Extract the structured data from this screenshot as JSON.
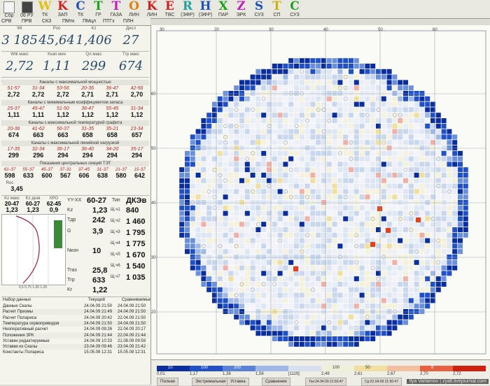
{
  "toolbar": {
    "buttons": [
      {
        "big": "",
        "small": "Сбр",
        "color": "#a0a0a0"
      },
      {
        "big": "",
        "small": "06 РУ",
        "color": "#606060"
      },
      {
        "big": "W",
        "small": "ТК",
        "color": "#e0c010"
      },
      {
        "big": "K",
        "small": "ЗАП",
        "color": "#d02020"
      },
      {
        "big": "C",
        "small": "ТК",
        "color": "#2050c0"
      },
      {
        "big": "T",
        "small": "ГР",
        "color": "#20a020"
      },
      {
        "big": "T",
        "small": "ГАЗА",
        "color": "#c020c0"
      },
      {
        "big": "O",
        "small": "ЛИН",
        "color": "#e08010"
      },
      {
        "big": "K",
        "small": "ЛИН",
        "color": "#d02020"
      },
      {
        "big": "E",
        "small": "ТВС",
        "color": "#d02020"
      },
      {
        "big": "R",
        "small": "(ЭФР)",
        "color": "#20a0a0"
      },
      {
        "big": "H",
        "small": "(ЭФР)",
        "color": "#2050c0"
      },
      {
        "big": "X",
        "small": "ПАР",
        "color": "#20a020"
      },
      {
        "big": "Z",
        "small": "ЭРК",
        "color": "#c020c0"
      },
      {
        "big": "S",
        "small": "СУЗ",
        "color": "#2050c0"
      },
      {
        "big": "T",
        "small": "СП",
        "color": "#d0b010"
      },
      {
        "big": "C",
        "small": "СУЗ",
        "color": "#20a020"
      }
    ],
    "modes": [
      "СРВ",
      "ПРВ",
      "СКЗ",
      "ПМтк",
      "ПМцл",
      "ПТГз",
      "ПЛН"
    ]
  },
  "summary": {
    "row1": [
      {
        "label": "Wt",
        "value": "3 185"
      },
      {
        "label": "Poo",
        "value": "45,64"
      },
      {
        "label": "Kz",
        "value": "1,406"
      },
      {
        "label": "Дисл",
        "value": "27"
      }
    ],
    "row2": [
      {
        "label": "Wtk макс",
        "value": "2,72"
      },
      {
        "label": "Kкап мин",
        "value": "1,11"
      },
      {
        "label": "Qл макс",
        "value": "299"
      },
      {
        "label": "Tгр макс",
        "value": "674"
      }
    ]
  },
  "sections": [
    {
      "title": "Каналы с максимальной мощностью",
      "coords": [
        "51-57",
        "31-34",
        "53-56",
        "20-36",
        "36-47",
        "42-56"
      ],
      "values": [
        "2,72",
        "2,72",
        "2,72",
        "2,71",
        "2,71",
        "2,70"
      ]
    },
    {
      "title": "Каналы с минимальным коэффициентом запаса",
      "coords": [
        "25-37",
        "45-47",
        "51-50",
        "36-47",
        "55-45",
        "31-34"
      ],
      "values": [
        "1,11",
        "1,11",
        "1,12",
        "1,12",
        "1,12",
        "1,12"
      ]
    },
    {
      "title": "Каналы с максимальной температурой графита",
      "coords": [
        "20-36",
        "41-62",
        "56-37",
        "31-35",
        "35-21",
        "23-34"
      ],
      "values": [
        "674",
        "663",
        "663",
        "658",
        "658",
        "657"
      ]
    },
    {
      "title": "Каналы с максимальной линейной нагрузкой",
      "coords": [
        "17-35",
        "32-34",
        "36-17",
        "36-40",
        "34-20",
        "35-17"
      ],
      "values": [
        "299",
        "296",
        "294",
        "294",
        "294",
        "294"
      ]
    }
  ],
  "central": {
    "title": "Показания центральных секций ТЭТ",
    "coords": [
      "61-37",
      "55-37",
      "45-37",
      "37-31",
      "37-45",
      "31-37",
      "21-37",
      "15-37"
    ],
    "values": [
      "598",
      "633",
      "600",
      "567",
      "606",
      "638",
      "580",
      "642"
    ],
    "ros_label": "Rос",
    "ros_value": "3,45"
  },
  "kz_block": {
    "labels": [
      "Kz макс",
      "Kz дкзв",
      "КРО"
    ],
    "coords": [
      "20-47",
      "60-27",
      "62-45"
    ],
    "values": [
      "1,23",
      "1,23",
      "0,9"
    ],
    "graph_axis": "0,5 0,75 1,00 1,25"
  },
  "params": {
    "yy_label": "YY-XX",
    "yy_value": "60-27",
    "tip_label": "Тип",
    "tip_value": "ДКЭв",
    "items": [
      {
        "label": "Kz",
        "value": "1,23"
      },
      {
        "label": "Tдр",
        "value": "242"
      },
      {
        "label": "G",
        "value": "3,9"
      },
      {
        "label": "Nкон",
        "value": "10"
      },
      {
        "label": "Tгаз",
        "value": "25,8"
      },
      {
        "label": "Tгр",
        "value": "633"
      },
      {
        "label": "Kr",
        "value": "1,22"
      }
    ],
    "dk": [
      {
        "label": "Щ ч1",
        "value": "840"
      },
      {
        "label": "Щ ч2",
        "value": "1 460"
      },
      {
        "label": "Щ ч3",
        "value": "1 795"
      },
      {
        "label": "Щ ч4",
        "value": "1 775"
      },
      {
        "label": "Щ ч5",
        "value": "1 670"
      },
      {
        "label": "Щ ч6",
        "value": "1 540"
      },
      {
        "label": "Щ ч7",
        "value": "1 035"
      }
    ]
  },
  "datasets": {
    "headers": [
      "Набор данных",
      "Текущий",
      "Сравниваемый"
    ],
    "rows": [
      [
        "Данные Скалы",
        "24.04.09 21:50",
        "24.04.09 21:50"
      ],
      [
        "Расчет Призмы",
        "24.04.09 21:49",
        "24.04.09 21:50"
      ],
      [
        "Расчет Полариса",
        "24.04.09 20:42",
        "22.04.09 21:50"
      ],
      [
        "Температура сервоприводов",
        "24.04.09 21:50",
        "24.04.09 21:50"
      ],
      [
        "Неоперативный расчет",
        "24.04.09 09:26",
        "22.04.09 20:17"
      ],
      [
        "Положения ЗРК",
        "24.04.09 21:44",
        "22.04.09 21:44"
      ],
      [
        "Уставки редактируемые",
        "24.04.09 10:33",
        "21.08.09 09:59"
      ],
      [
        "Уставки из Скалы",
        "23.04.09 09:46",
        "23.04.09 21:42"
      ],
      [
        "Константы Полариса",
        "15.05.08 12:31",
        "15.05.08 12:31"
      ]
    ]
  },
  "map": {
    "col_labels": [
      "30",
      "20",
      "30",
      "40",
      "50",
      "60"
    ],
    "row_labels": [
      "60",
      "50",
      "40",
      "30",
      "20"
    ]
  },
  "legend": {
    "ticks": [
      "0,01",
      "1,17",
      "1,38",
      "1,56",
      "[1119]",
      "2,49",
      "2,61",
      "2,67",
      "2,70",
      "2,72"
    ],
    "counts": [
      "10",
      "100",
      "200",
      "",
      "",
      "100",
      "50",
      "",
      "8",
      ""
    ],
    "colors": [
      "#0a2ea0",
      "#2050c8",
      "#5a80d8",
      "#a0b8e8",
      "#d8e0f0",
      "#f0f0d8",
      "#f0e0a0",
      "#f0c0a0",
      "#e86040",
      "#d02010"
    ],
    "tabs": [
      "Полная",
      "Экстремальная",
      "Уставка",
      "Сравнение"
    ],
    "status": [
      "Тек:24.04.09 21:50:47",
      "Ср:22.04.09 21:50:47"
    ]
  },
  "watermark": "Ilya Varlamov | zyalt.livejournal.com"
}
